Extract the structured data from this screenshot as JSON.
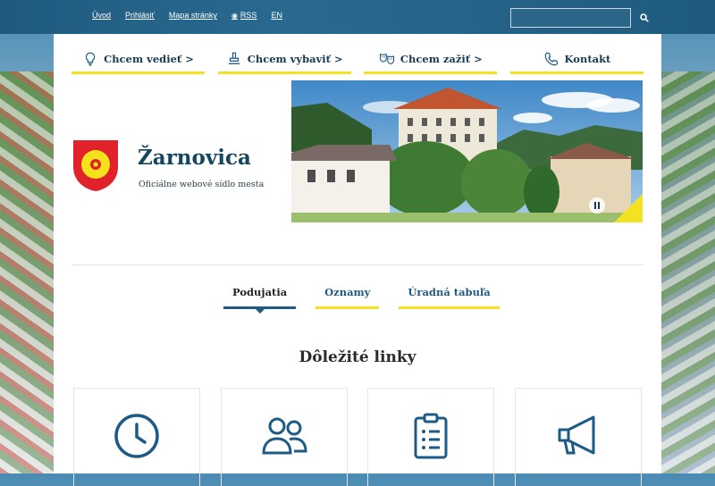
{
  "top_links": [
    "Úvod",
    "Prihlásiť",
    "Mapa stránky",
    "RSS",
    "EN"
  ],
  "search": {
    "placeholder": ""
  },
  "nav": [
    {
      "label": "Chcem vedieť >",
      "icon": "lightbulb-icon"
    },
    {
      "label": "Chcem vybaviť >",
      "icon": "stamp-icon"
    },
    {
      "label": "Chcem zažiť >",
      "icon": "theater-masks-icon"
    },
    {
      "label": "Kontakt",
      "icon": "phone-icon"
    }
  ],
  "site": {
    "name": "Žarnovica",
    "subtitle": "Oficiálne webové sídlo mesta"
  },
  "tabs": [
    "Podujatia",
    "Oznamy",
    "Úradná tabuľa"
  ],
  "section": {
    "title": "Dôležité linky"
  },
  "cards": [
    {
      "icon": "clock-icon"
    },
    {
      "icon": "people-icon"
    },
    {
      "icon": "clipboard-list-icon"
    },
    {
      "icon": "megaphone-icon"
    }
  ],
  "colors": {
    "primary": "#1d5b86",
    "accent": "#f2e221",
    "dark": "#15465f"
  }
}
